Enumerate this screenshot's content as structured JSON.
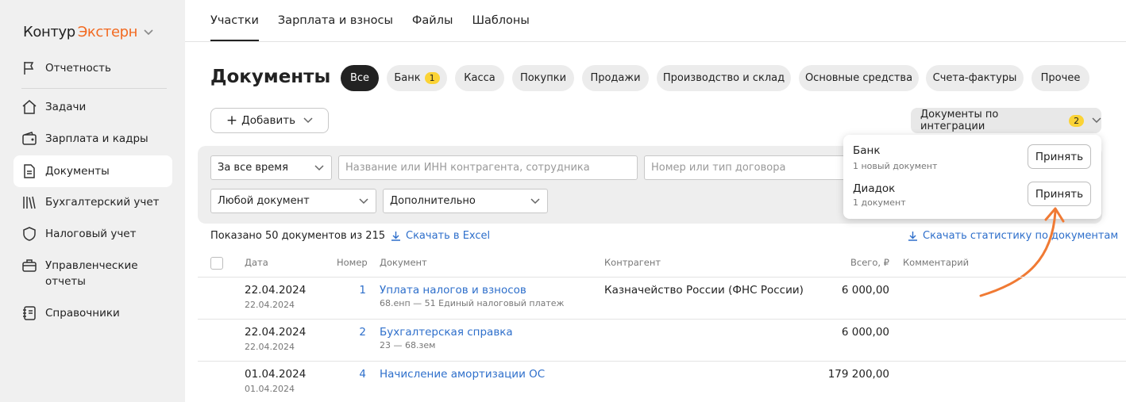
{
  "app": {
    "logo_part1": "Контур",
    "logo_part2": "Экстерн"
  },
  "sidebar": {
    "items": [
      {
        "label": "Отчетность",
        "icon": "flag-icon"
      },
      {
        "label": "Задачи",
        "icon": "home-icon"
      },
      {
        "label": "Зарплата и кадры",
        "icon": "wallet-icon"
      },
      {
        "label": "Документы",
        "icon": "document-icon"
      },
      {
        "label": "Бухгалтерский учет",
        "icon": "books-icon"
      },
      {
        "label": "Налоговый учет",
        "icon": "shield-icon"
      },
      {
        "label": "Управленческие",
        "label2": "отчеты",
        "icon": "briefcase-icon"
      },
      {
        "label": "Справочники",
        "icon": "notebook-icon"
      }
    ]
  },
  "tabs": [
    "Участки",
    "Зарплата и взносы",
    "Файлы",
    "Шаблоны"
  ],
  "page_title": "Документы",
  "chips": [
    "Все",
    "Банк",
    "Касса",
    "Покупки",
    "Продажи",
    "Производство и склад",
    "Основные средства",
    "Счета-фактуры",
    "Прочее"
  ],
  "chip_bank_badge": "1",
  "add_button": "Добавить",
  "integration_button": {
    "label": "Документы по интеграции",
    "badge": "2"
  },
  "filters": {
    "period": "За все время",
    "counterparty_placeholder": "Название или ИНН контрагента, сотрудника",
    "contract_placeholder": "Номер или тип договора",
    "doc_type": "Любой документ",
    "extra": "Дополнительно"
  },
  "popup": {
    "items": [
      {
        "title": "Банк",
        "subtitle": "1 новый документ",
        "button": "Принять"
      },
      {
        "title": "Диадок",
        "subtitle": "1 документ",
        "button": "Принять"
      }
    ]
  },
  "summary": {
    "shown": "Показано 50 документов из 215",
    "excel": "Скачать в Excel",
    "stats": "Скачать статистику по документам"
  },
  "table": {
    "headers": {
      "date": "Дата",
      "number": "Номер",
      "document": "Документ",
      "counterparty": "Контрагент",
      "total": "Всего, ₽",
      "comment": "Комментарий"
    },
    "rows": [
      {
        "date": "22.04.2024",
        "date2": "22.04.2024",
        "number": "1",
        "doc": "Уплата налогов и взносов",
        "doc_sub": "68.енп — 51 Единый налоговый платеж",
        "counterparty": "Казначейство России (ФНС России)",
        "total": "6 000,00"
      },
      {
        "date": "22.04.2024",
        "date2": "22.04.2024",
        "number": "2",
        "doc": "Бухгалтерская справка",
        "doc_sub": "23 — 68.зем",
        "counterparty": "",
        "total": "6 000,00"
      },
      {
        "date": "01.04.2024",
        "date2": "01.04.2024",
        "number": "4",
        "doc": "Начисление амортизации ОС",
        "doc_sub": "",
        "counterparty": "",
        "total": "179 200,00"
      }
    ]
  },
  "colors": {
    "brand_orange": "#f26a21",
    "link_blue": "#2e6fcb",
    "badge_yellow": "#fbd335"
  }
}
